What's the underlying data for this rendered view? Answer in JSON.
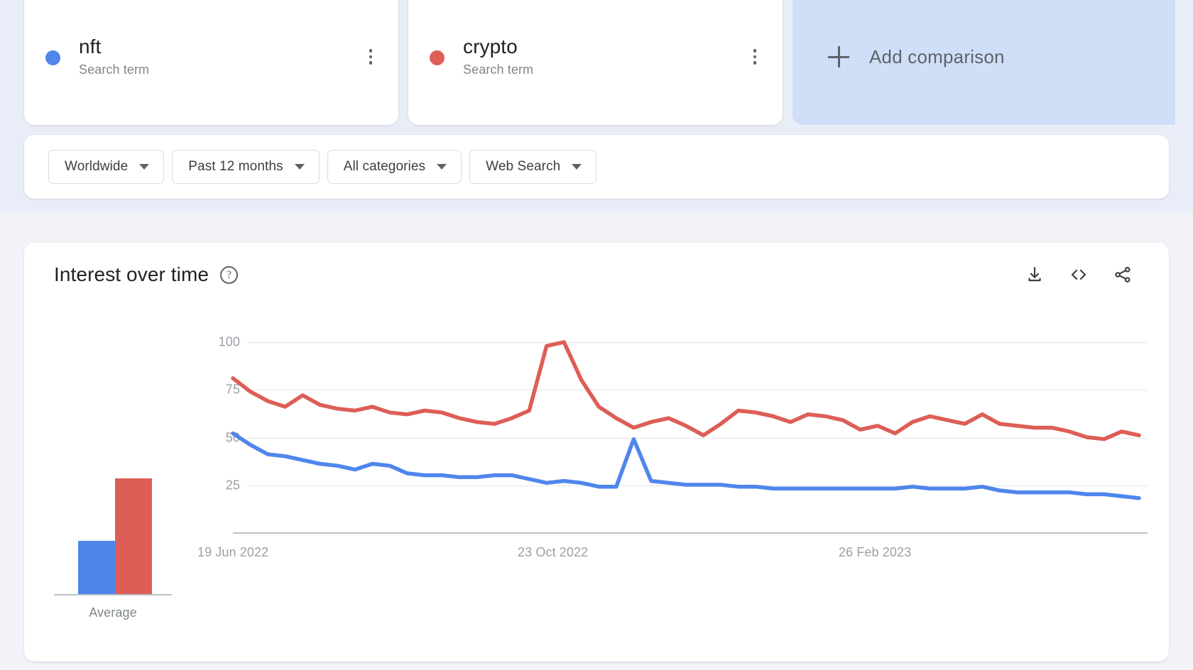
{
  "colors": {
    "series_blue": "#4f86ec",
    "series_red": "#dd5e56",
    "page_background": "#f1f3f9",
    "top_band": "#e9edf8",
    "add_comparison_background": "#cfdff8",
    "card_background": "#ffffff",
    "gridline": "#e4e6e8",
    "axis": "#bdc1c6",
    "muted_text": "#9aa0a6"
  },
  "terms": [
    {
      "title": "nft",
      "subtitle": "Search term",
      "color": "#4f86ec",
      "menu_icon": "kebab-menu-icon"
    },
    {
      "title": "crypto",
      "subtitle": "Search term",
      "color": "#dd5e56",
      "menu_icon": "kebab-menu-icon"
    }
  ],
  "add_comparison": {
    "label": "Add comparison",
    "icon": "plus-icon"
  },
  "filters": [
    {
      "label": "Worldwide",
      "icon": "chevron-down-icon"
    },
    {
      "label": "Past 12 months",
      "icon": "chevron-down-icon"
    },
    {
      "label": "All categories",
      "icon": "chevron-down-icon"
    },
    {
      "label": "Web Search",
      "icon": "chevron-down-icon"
    }
  ],
  "chart_card": {
    "title": "Interest over time",
    "help_icon": "help-circle-icon",
    "help_glyph": "?",
    "actions": [
      {
        "name": "download-icon",
        "tooltip": "Download"
      },
      {
        "name": "embed-code-icon",
        "tooltip": "Embed",
        "glyph": "<>"
      },
      {
        "name": "share-icon",
        "tooltip": "Share"
      }
    ]
  },
  "chart_data": {
    "type": "line",
    "title": "Interest over time",
    "xlabel": "",
    "ylabel": "",
    "ylim": [
      0,
      107
    ],
    "yticks": [
      25,
      50,
      75,
      100
    ],
    "ytick_labels": [
      "25",
      "50",
      "75",
      "100"
    ],
    "grid": true,
    "legend": "none",
    "xtick_labels": [
      "19 Jun 2022",
      "23 Oct 2022",
      "26 Feb 2023"
    ],
    "xtick_positions": [
      0,
      18,
      36
    ],
    "x_count": 53,
    "series": [
      {
        "name": "nft",
        "color": "#4f86ec",
        "values": [
          52,
          46,
          41,
          40,
          38,
          36,
          35,
          33,
          36,
          35,
          31,
          30,
          30,
          29,
          29,
          30,
          30,
          28,
          26,
          27,
          26,
          24,
          24,
          49,
          27,
          26,
          25,
          25,
          25,
          24,
          24,
          23,
          23,
          23,
          23,
          23,
          23,
          23,
          23,
          24,
          23,
          23,
          23,
          24,
          22,
          21,
          21,
          21,
          21,
          20,
          20,
          19,
          18
        ]
      },
      {
        "name": "crypto",
        "color": "#dd5e56",
        "values": [
          81,
          74,
          69,
          66,
          72,
          67,
          65,
          64,
          66,
          63,
          62,
          64,
          63,
          60,
          58,
          57,
          60,
          64,
          98,
          100,
          80,
          66,
          60,
          55,
          58,
          60,
          56,
          51,
          57,
          64,
          63,
          61,
          58,
          62,
          61,
          59,
          54,
          56,
          52,
          58,
          61,
          59,
          57,
          62,
          57,
          56,
          55,
          55,
          53,
          50,
          49,
          53,
          51
        ]
      }
    ],
    "average_bars": {
      "label": "Average",
      "categories": [
        "nft",
        "crypto"
      ],
      "values": [
        28,
        61
      ],
      "colors": [
        "#4f86ec",
        "#dd5e56"
      ]
    }
  }
}
